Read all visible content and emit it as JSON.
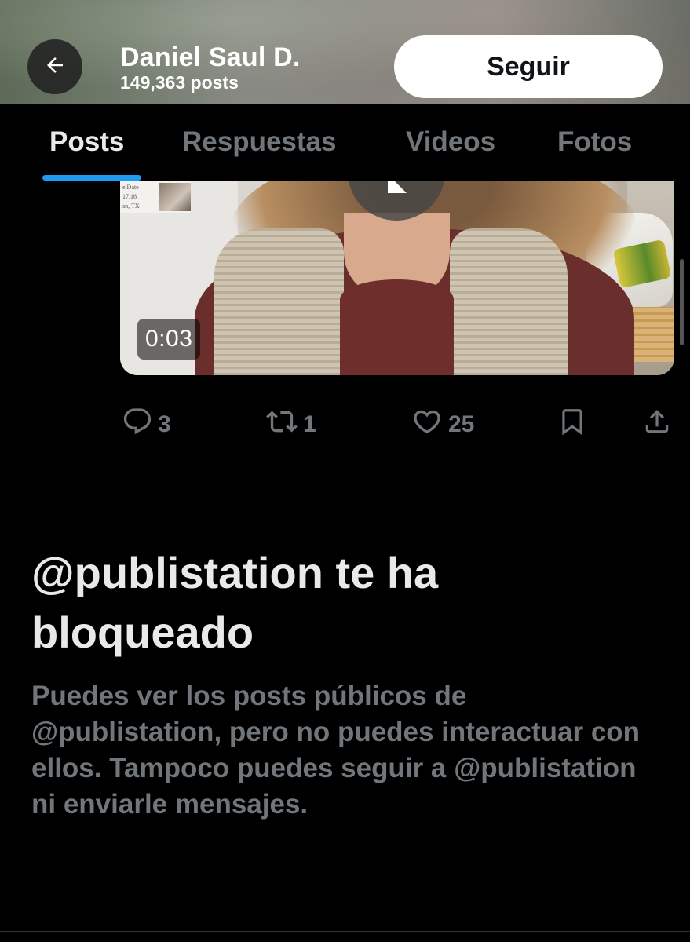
{
  "header": {
    "name": "Daniel Saul D.",
    "post_count": "149,363 posts",
    "follow_label": "Seguir",
    "back_icon": "arrow-left-icon"
  },
  "tabs": [
    {
      "label": "Posts",
      "active": true
    },
    {
      "label": "Respuestas",
      "active": false
    },
    {
      "label": "Videos",
      "active": false
    },
    {
      "label": "Fotos",
      "active": false
    }
  ],
  "post": {
    "video_duration": "0:03",
    "paper_text": "e Date\n17.16\nsn, TX",
    "actions": {
      "replies": "3",
      "reposts": "1",
      "likes": "25"
    }
  },
  "blocked": {
    "title": "@publistation te ha bloqueado",
    "description": "Puedes ver los posts públicos de @publistation, pero no puedes interactuar con ellos. Tampoco puedes seguir a @publistation ni enviarle mensajes."
  },
  "colors": {
    "background": "#000000",
    "accent": "#1d9bf0",
    "muted_text": "#71767b",
    "primary_text": "#e7e9ea"
  }
}
